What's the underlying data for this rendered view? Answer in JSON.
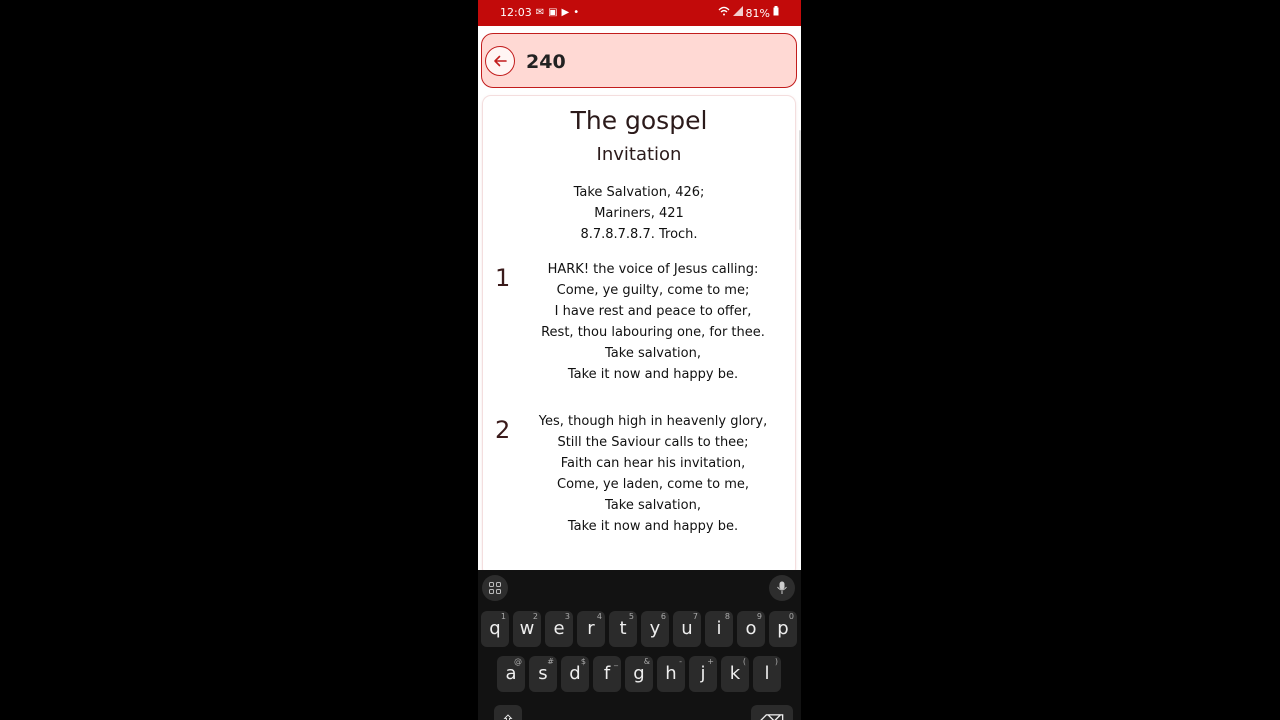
{
  "status_bar": {
    "time": "12:03",
    "battery": "81%"
  },
  "header": {
    "hymn_number": "240"
  },
  "hymn": {
    "title": "The gospel",
    "subtitle": "Invitation",
    "tunes": [
      "Take Salvation, 426;",
      "Mariners, 421",
      "8.7.8.7.8.7. Troch."
    ],
    "verses": [
      {
        "number": "1",
        "lines": [
          "HARK! the voice of Jesus calling:",
          "Come, ye guilty, come to me;",
          "I have rest and peace to offer,",
          "Rest, thou labouring one, for thee.",
          "Take salvation,",
          "Take it now and happy be."
        ]
      },
      {
        "number": "2",
        "lines": [
          "Yes, though high in heavenly glory,",
          "Still the Saviour calls to thee;",
          "Faith can hear his invitation,",
          "Come, ye laden, come to me,",
          "Take salvation,",
          "Take it now and happy be."
        ]
      }
    ]
  },
  "keyboard": {
    "row1": [
      {
        "k": "q",
        "s": "1"
      },
      {
        "k": "w",
        "s": "2"
      },
      {
        "k": "e",
        "s": "3"
      },
      {
        "k": "r",
        "s": "4"
      },
      {
        "k": "t",
        "s": "5"
      },
      {
        "k": "y",
        "s": "6"
      },
      {
        "k": "u",
        "s": "7"
      },
      {
        "k": "i",
        "s": "8"
      },
      {
        "k": "o",
        "s": "9"
      },
      {
        "k": "p",
        "s": "0"
      }
    ],
    "row2": [
      {
        "k": "a",
        "s": "@"
      },
      {
        "k": "s",
        "s": "#"
      },
      {
        "k": "d",
        "s": "$"
      },
      {
        "k": "f",
        "s": "_"
      },
      {
        "k": "g",
        "s": "&"
      },
      {
        "k": "h",
        "s": "-"
      },
      {
        "k": "j",
        "s": "+"
      },
      {
        "k": "k",
        "s": "("
      },
      {
        "k": "l",
        "s": ")"
      }
    ]
  }
}
